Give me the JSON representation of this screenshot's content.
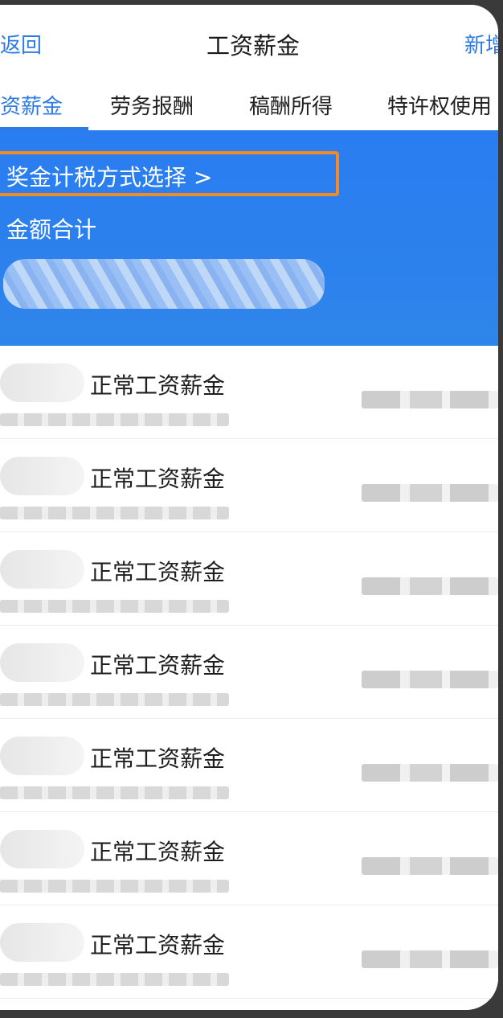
{
  "nav": {
    "back_label": "返回",
    "title": "工资薪金",
    "add_label": "新增"
  },
  "tabs": [
    {
      "label": "资薪金"
    },
    {
      "label": "劳务报酬"
    },
    {
      "label": "稿酬所得"
    },
    {
      "label": "特许权使用"
    }
  ],
  "banner": {
    "bonus_method_label": "奖金计税方式选择 >",
    "total_label": "金额合计"
  },
  "records": [
    {
      "title": "正常工资薪金"
    },
    {
      "title": "正常工资薪金"
    },
    {
      "title": "正常工资薪金"
    },
    {
      "title": "正常工资薪金"
    },
    {
      "title": "正常工资薪金"
    },
    {
      "title": "正常工资薪金"
    },
    {
      "title": "正常工资薪金"
    }
  ],
  "colors": {
    "accent": "#2f7be5",
    "banner": "#2a7df1",
    "highlight": "#f08a2a"
  }
}
